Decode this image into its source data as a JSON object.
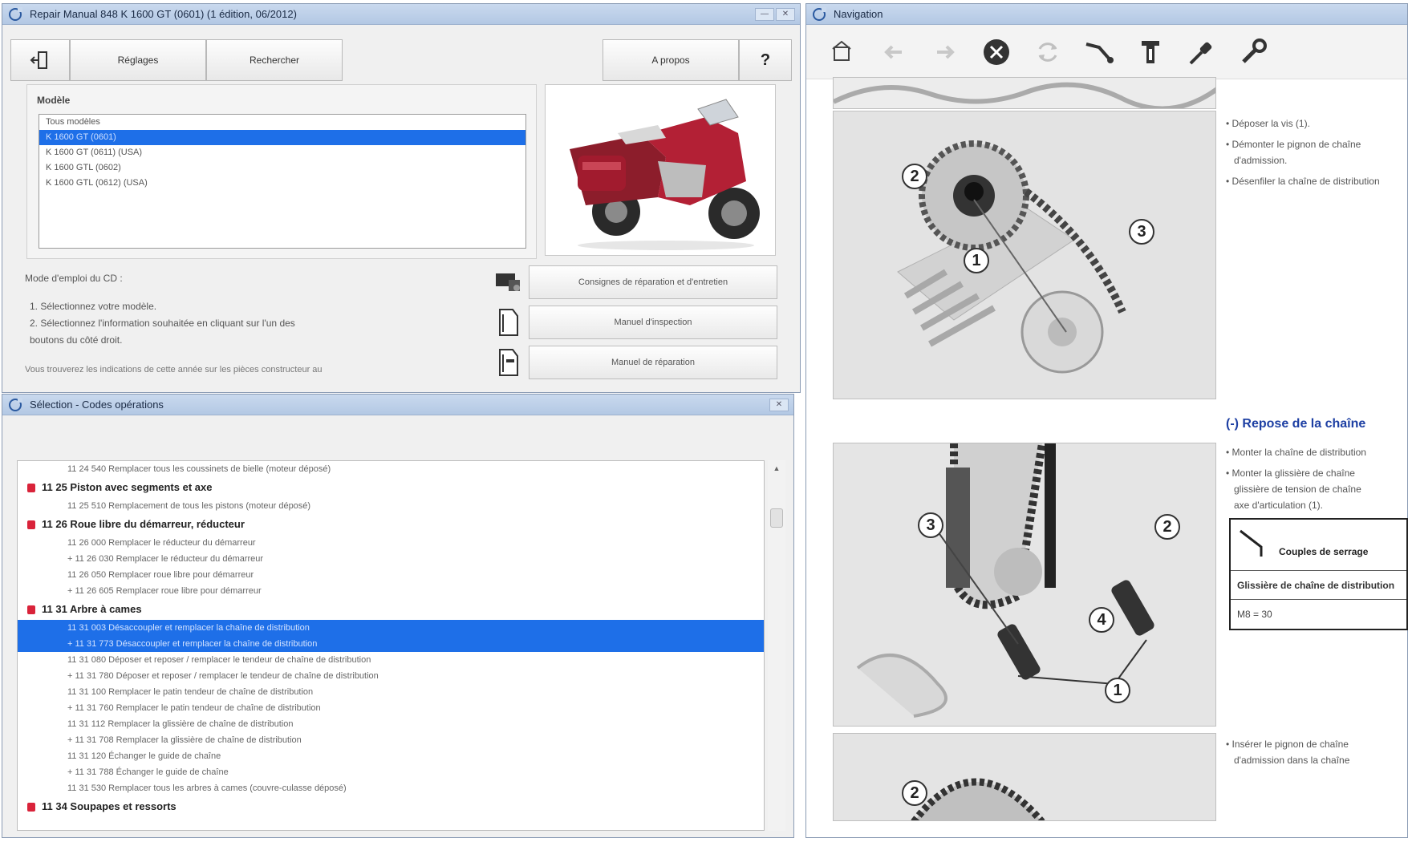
{
  "window_main": {
    "title": "Repair Manual 848 K 1600 GT (0601) (1 édition, 06/2012)",
    "toolbar": {
      "settings_label": "Réglages",
      "search_label": "Rechercher",
      "about_label": "A propos",
      "help_label": "?"
    },
    "models_panel": {
      "title": "Modèle",
      "models": [
        "Tous modèles",
        "K 1600 GT (0601)",
        "K 1600 GT (0611) (USA)",
        "K 1600 GTL (0602)",
        "K 1600 GTL (0612) (USA)"
      ],
      "selected_index": 1
    },
    "instructions": {
      "title": "Mode d'emploi du CD :",
      "step1": "1. Sélectionnez votre modèle.",
      "step2": "2. Sélectionnez l'information souhaitée en cliquant sur l'un des",
      "step2b": "boutons du côté droit.",
      "footer": "Vous trouverez les indications de cette année sur les pièces constructeur au"
    },
    "buttons": {
      "repair_instructions": "Consignes de réparation et d'entretien",
      "inspection_manual": "Manuel d'inspection",
      "repair_manual": "Manuel de réparation"
    }
  },
  "window_ops": {
    "title": "Sélection - Codes opérations",
    "rows": [
      {
        "kind": "op",
        "text": "11 24 540 Remplacer tous les coussinets de bielle (moteur déposé)"
      },
      {
        "kind": "header",
        "text": "11 25  Piston avec segments et axe"
      },
      {
        "kind": "op",
        "text": "11 25 510 Remplacement de tous les pistons (moteur déposé)"
      },
      {
        "kind": "header",
        "text": "11 26  Roue libre du démarreur, réducteur"
      },
      {
        "kind": "op",
        "text": "11 26 000 Remplacer le réducteur du démarreur"
      },
      {
        "kind": "op",
        "text": "+ 11 26 030 Remplacer le réducteur du démarreur"
      },
      {
        "kind": "op",
        "text": "11 26 050 Remplacer roue libre pour démarreur"
      },
      {
        "kind": "op",
        "text": "+ 11 26 605 Remplacer roue libre pour démarreur"
      },
      {
        "kind": "header",
        "text": "11 31  Arbre à cames"
      },
      {
        "kind": "op",
        "sel": true,
        "text": "11 31 003 Désaccoupler et remplacer la chaîne de distribution"
      },
      {
        "kind": "op",
        "sel": true,
        "text": "+ 11 31 773 Désaccoupler et remplacer la chaîne de distribution"
      },
      {
        "kind": "op",
        "text": "11 31 080 Déposer et reposer / remplacer le tendeur de chaîne de distribution"
      },
      {
        "kind": "op",
        "text": "+ 11 31 780 Déposer et reposer / remplacer le tendeur de chaîne de distribution"
      },
      {
        "kind": "op",
        "text": "11 31 100 Remplacer le patin tendeur de chaîne de distribution"
      },
      {
        "kind": "op",
        "text": "+ 11 31 760 Remplacer le patin tendeur de chaîne de distribution"
      },
      {
        "kind": "op",
        "text": "11 31 112 Remplacer la glissière de chaîne de distribution"
      },
      {
        "kind": "op",
        "text": "+ 11 31 708 Remplacer la glissière de chaîne de distribution"
      },
      {
        "kind": "op",
        "text": "11 31 120 Échanger le guide de chaîne"
      },
      {
        "kind": "op",
        "text": "+ 11 31 788 Échanger le guide de chaîne"
      },
      {
        "kind": "op",
        "text": "11 31 530 Remplacer tous les arbres à cames (couvre-culasse déposé)"
      },
      {
        "kind": "header",
        "text": "11 34  Soupapes et ressorts"
      }
    ]
  },
  "window_nav": {
    "title": "Navigation",
    "right_text": {
      "line1": "• Déposer la vis (1).",
      "line2": "• Démonter le pignon de chaîne",
      "line3": "d'admission.",
      "line4": "• Désenfiler la chaîne de distribution",
      "heading": "(-) Repose de la chaîne",
      "line5": "• Monter la chaîne de distribution",
      "line6": "• Monter la glissière de chaîne",
      "line7": "glissière de tension de chaîne",
      "line8": "axe d'articulation (1).",
      "line9": "• Insérer le pignon de chaîne",
      "line10": "d'admission dans la chaîne"
    },
    "torque_table": {
      "title": "Couples de serrage",
      "row1": "Glissière de chaîne de distribution",
      "row2": "M8 = 30"
    },
    "diagram1_callouts": [
      "2",
      "1",
      "3"
    ],
    "diagram2_callouts": [
      "3",
      "2",
      "4",
      "1"
    ],
    "diagram3_callouts": [
      "2"
    ]
  }
}
